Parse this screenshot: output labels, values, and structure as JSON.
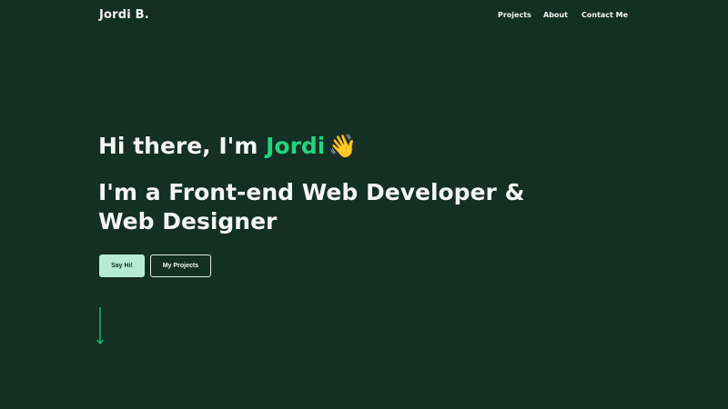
{
  "header": {
    "brand": "Jordi B.",
    "nav": [
      {
        "label": "Projects"
      },
      {
        "label": "About"
      },
      {
        "label": "Contact Me"
      }
    ]
  },
  "hero": {
    "greeting_prefix": "Hi there, I'm ",
    "name": "Jordi",
    "emoji": "👋",
    "tagline": "I'm a Front-end Web Developer & Web Designer"
  },
  "actions": {
    "primary_label": "Say Hi!",
    "secondary_label": "My Projects"
  },
  "icons": {
    "scroll": "arrow-down-icon",
    "wave": "waving-hand-icon"
  },
  "colors": {
    "background": "#142f24",
    "accent": "#22d47d",
    "primary_button_bg": "#b7ead6",
    "text": "#f3f6f4"
  }
}
